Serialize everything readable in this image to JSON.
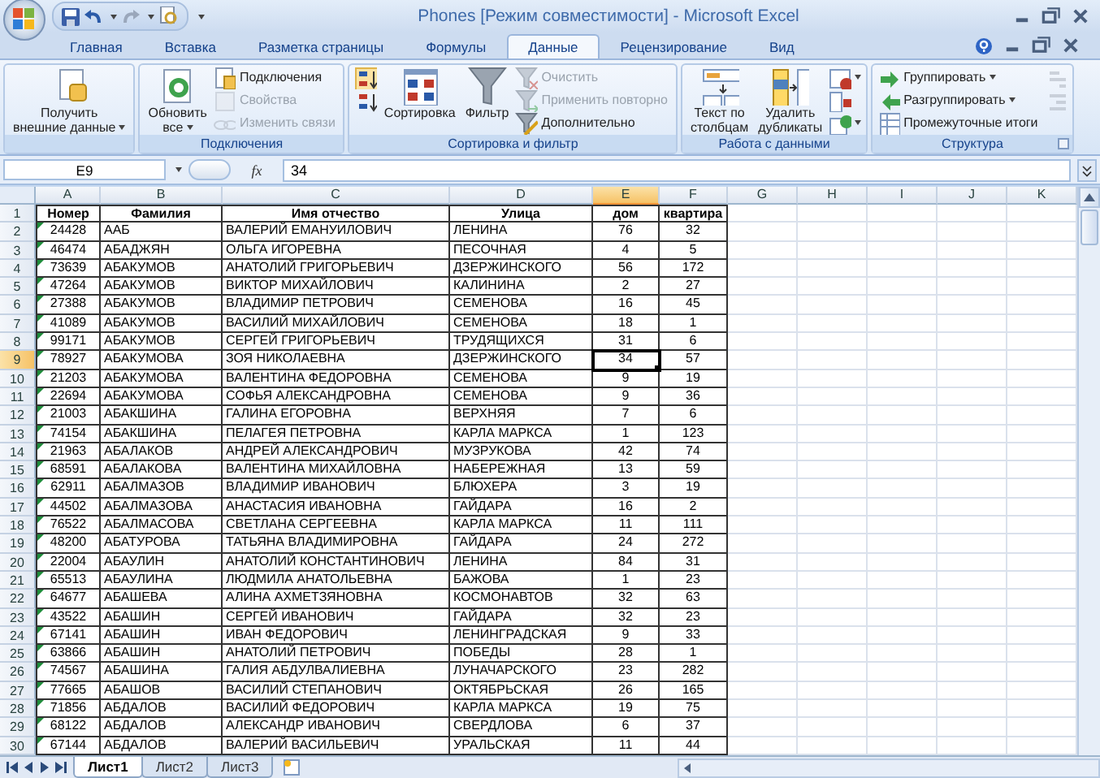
{
  "title_bar": {
    "title": "Phones  [Режим совместимости] - Microsoft Excel"
  },
  "ribbon_tabs": [
    {
      "label": "Главная",
      "selected": false
    },
    {
      "label": "Вставка",
      "selected": false
    },
    {
      "label": "Разметка страницы",
      "selected": false
    },
    {
      "label": "Формулы",
      "selected": false
    },
    {
      "label": "Данные",
      "selected": true
    },
    {
      "label": "Рецензирование",
      "selected": false
    },
    {
      "label": "Вид",
      "selected": false
    }
  ],
  "ribbon_groups": [
    {
      "items": [
        {
          "kind": "large",
          "label": "Получить\nвнешние данные",
          "dropdown": true,
          "disabled": false
        }
      ]
    },
    {
      "label": "Подключения",
      "items": [
        {
          "kind": "large",
          "label": "Обновить\nвсе",
          "dropdown": true,
          "disabled": false
        },
        {
          "kind": "small",
          "label": "Подключения",
          "dropdown": false,
          "disabled": false
        },
        {
          "kind": "small",
          "label": "Свойства",
          "dropdown": false,
          "disabled": true
        },
        {
          "kind": "small",
          "label": "Изменить связи",
          "dropdown": false,
          "disabled": true
        }
      ]
    },
    {
      "label": "Сортировка и фильтр",
      "items": [
        {
          "kind": "icon",
          "dropdown": false,
          "disabled": false
        },
        {
          "kind": "icon",
          "dropdown": false,
          "disabled": false
        },
        {
          "kind": "large",
          "label": "Сортировка",
          "dropdown": false,
          "disabled": false
        },
        {
          "kind": "large",
          "label": "Фильтр",
          "dropdown": false,
          "disabled": false
        },
        {
          "kind": "small",
          "label": "Очистить",
          "dropdown": false,
          "disabled": true
        },
        {
          "kind": "small",
          "label": "Применить повторно",
          "dropdown": false,
          "disabled": true
        },
        {
          "kind": "small",
          "label": "Дополнительно",
          "dropdown": false,
          "disabled": false
        }
      ]
    },
    {
      "label": "Работа с данными",
      "items": [
        {
          "kind": "large",
          "label": "Текст по\nстолбцам",
          "dropdown": false,
          "disabled": false
        },
        {
          "kind": "large",
          "label": "Удалить\nдубликаты",
          "dropdown": false,
          "disabled": false
        },
        {
          "kind": "icon",
          "dropdown": true,
          "disabled": false
        },
        {
          "kind": "icon",
          "dropdown": false,
          "disabled": false
        },
        {
          "kind": "icon",
          "dropdown": true,
          "disabled": false
        }
      ]
    },
    {
      "label": "Структура",
      "launcher": true,
      "items": [
        {
          "kind": "small",
          "label": "Группировать",
          "dropdown": true,
          "disabled": false
        },
        {
          "kind": "small",
          "label": "Разгруппировать",
          "dropdown": true,
          "disabled": false
        },
        {
          "kind": "small",
          "label": "Промежуточные итоги",
          "dropdown": false,
          "disabled": false
        },
        {
          "kind": "icon",
          "dropdown": false,
          "disabled": true
        },
        {
          "kind": "icon",
          "dropdown": false,
          "disabled": true
        }
      ]
    }
  ],
  "formula_bar": {
    "name_box": "E9",
    "function_label": "fx",
    "value": "34"
  },
  "columns": [
    {
      "label": "A",
      "selected": false
    },
    {
      "label": "B",
      "selected": false
    },
    {
      "label": "C",
      "selected": false
    },
    {
      "label": "D",
      "selected": false
    },
    {
      "label": "E",
      "selected": true
    },
    {
      "label": "F",
      "selected": false
    },
    {
      "label": "G",
      "selected": false
    },
    {
      "label": "H",
      "selected": false
    },
    {
      "label": "I",
      "selected": false
    },
    {
      "label": "J",
      "selected": false
    },
    {
      "label": "K",
      "selected": false
    }
  ],
  "rows": [
    {
      "number": "1",
      "kind": "header",
      "selected": false,
      "error_marker": false,
      "cells": [
        "Номер",
        "Фамилия",
        "Имя отчество",
        "Улица",
        "дом",
        "квартира"
      ]
    },
    {
      "number": "2",
      "kind": "data",
      "selected": false,
      "error_marker": true,
      "cells": [
        "24428",
        "ААБ",
        "ВАЛЕРИЙ ЕМАНУИЛОВИЧ",
        "ЛЕНИНА",
        "76",
        "32"
      ]
    },
    {
      "number": "3",
      "kind": "data",
      "selected": false,
      "error_marker": true,
      "cells": [
        "46474",
        "АБАДЖЯН",
        "ОЛЬГА ИГОРЕВНА",
        "ПЕСОЧНАЯ",
        "4",
        "5"
      ]
    },
    {
      "number": "4",
      "kind": "data",
      "selected": false,
      "error_marker": true,
      "cells": [
        "73639",
        "АБАКУМОВ",
        "АНАТОЛИЙ ГРИГОРЬЕВИЧ",
        "ДЗЕРЖИНСКОГО",
        "56",
        "172"
      ]
    },
    {
      "number": "5",
      "kind": "data",
      "selected": false,
      "error_marker": true,
      "cells": [
        "47264",
        "АБАКУМОВ",
        "ВИКТОР МИХАЙЛОВИЧ",
        "КАЛИНИНА",
        "2",
        "27"
      ]
    },
    {
      "number": "6",
      "kind": "data",
      "selected": false,
      "error_marker": true,
      "cells": [
        "27388",
        "АБАКУМОВ",
        "ВЛАДИМИР ПЕТРОВИЧ",
        "СЕМЕНОВА",
        "16",
        "45"
      ]
    },
    {
      "number": "7",
      "kind": "data",
      "selected": false,
      "error_marker": true,
      "cells": [
        "41089",
        "АБАКУМОВ",
        "ВАСИЛИЙ МИХАЙЛОВИЧ",
        "СЕМЕНОВА",
        "18",
        "1"
      ]
    },
    {
      "number": "8",
      "kind": "data",
      "selected": false,
      "error_marker": true,
      "cells": [
        "99171",
        "АБАКУМОВ",
        "СЕРГЕЙ ГРИГОРЬЕВИЧ",
        "ТРУДЯЩИХСЯ",
        "31",
        "6"
      ]
    },
    {
      "number": "9",
      "kind": "data",
      "selected": true,
      "error_marker": true,
      "cells": [
        "78927",
        "АБАКУМОВА",
        "ЗОЯ НИКОЛАЕВНА",
        "ДЗЕРЖИНСКОГО",
        "34",
        "57"
      ]
    },
    {
      "number": "10",
      "kind": "data",
      "selected": false,
      "error_marker": true,
      "cells": [
        "21203",
        "АБАКУМОВА",
        "ВАЛЕНТИНА ФЕДОРОВНА",
        "СЕМЕНОВА",
        "9",
        "19"
      ]
    },
    {
      "number": "11",
      "kind": "data",
      "selected": false,
      "error_marker": true,
      "cells": [
        "22694",
        "АБАКУМОВА",
        "СОФЬЯ АЛЕКСАНДРОВНА",
        "СЕМЕНОВА",
        "9",
        "36"
      ]
    },
    {
      "number": "12",
      "kind": "data",
      "selected": false,
      "error_marker": true,
      "cells": [
        "21003",
        "АБАКШИНА",
        "ГАЛИНА ЕГОРОВНА",
        "ВЕРХНЯЯ",
        "7",
        "6"
      ]
    },
    {
      "number": "13",
      "kind": "data",
      "selected": false,
      "error_marker": true,
      "cells": [
        "74154",
        "АБАКШИНА",
        "ПЕЛАГЕЯ ПЕТРОВНА",
        "КАРЛА МАРКСА",
        "1",
        "123"
      ]
    },
    {
      "number": "14",
      "kind": "data",
      "selected": false,
      "error_marker": true,
      "cells": [
        "21963",
        "АБАЛАКОВ",
        "АНДРЕЙ АЛЕКСАНДРОВИЧ",
        "МУЗРУКОВА",
        "42",
        "74"
      ]
    },
    {
      "number": "15",
      "kind": "data",
      "selected": false,
      "error_marker": true,
      "cells": [
        "68591",
        "АБАЛАКОВА",
        "ВАЛЕНТИНА МИХАЙЛОВНА",
        "НАБЕРЕЖНАЯ",
        "13",
        "59"
      ]
    },
    {
      "number": "16",
      "kind": "data",
      "selected": false,
      "error_marker": true,
      "cells": [
        "62911",
        "АБАЛМАЗОВ",
        "ВЛАДИМИР ИВАНОВИЧ",
        "БЛЮХЕРА",
        "3",
        "19"
      ]
    },
    {
      "number": "17",
      "kind": "data",
      "selected": false,
      "error_marker": true,
      "cells": [
        "44502",
        "АБАЛМАЗОВА",
        "АНАСТАСИЯ ИВАНОВНА",
        "ГАЙДАРА",
        "16",
        "2"
      ]
    },
    {
      "number": "18",
      "kind": "data",
      "selected": false,
      "error_marker": true,
      "cells": [
        "76522",
        "АБАЛМАСОВА",
        "СВЕТЛАНА СЕРГЕЕВНА",
        "КАРЛА МАРКСА",
        "11",
        "111"
      ]
    },
    {
      "number": "19",
      "kind": "data",
      "selected": false,
      "error_marker": true,
      "cells": [
        "48200",
        "АБАТУРОВА",
        "ТАТЬЯНА ВЛАДИМИРОВНА",
        "ГАЙДАРА",
        "24",
        "272"
      ]
    },
    {
      "number": "20",
      "kind": "data",
      "selected": false,
      "error_marker": true,
      "cells": [
        "22004",
        "АБАУЛИН",
        "АНАТОЛИЙ КОНСТАНТИНОВИЧ",
        "ЛЕНИНА",
        "84",
        "31"
      ]
    },
    {
      "number": "21",
      "kind": "data",
      "selected": false,
      "error_marker": true,
      "cells": [
        "65513",
        "АБАУЛИНА",
        "ЛЮДМИЛА АНАТОЛЬЕВНА",
        "БАЖОВА",
        "1",
        "23"
      ]
    },
    {
      "number": "22",
      "kind": "data",
      "selected": false,
      "error_marker": true,
      "cells": [
        "64677",
        "АБАШЕВА",
        "АЛИНА АХМЕТЗЯНОВНА",
        "КОСМОНАВТОВ",
        "32",
        "63"
      ]
    },
    {
      "number": "23",
      "kind": "data",
      "selected": false,
      "error_marker": true,
      "cells": [
        "43522",
        "АБАШИН",
        "СЕРГЕЙ ИВАНОВИЧ",
        "ГАЙДАРА",
        "32",
        "23"
      ]
    },
    {
      "number": "24",
      "kind": "data",
      "selected": false,
      "error_marker": true,
      "cells": [
        "67141",
        "АБАШИН",
        "ИВАН ФЕДОРОВИЧ",
        "ЛЕНИНГРАДСКАЯ",
        "9",
        "33"
      ]
    },
    {
      "number": "25",
      "kind": "data",
      "selected": false,
      "error_marker": true,
      "cells": [
        "63866",
        "АБАШИН",
        "АНАТОЛИЙ ПЕТРОВИЧ",
        "ПОБЕДЫ",
        "28",
        "1"
      ]
    },
    {
      "number": "26",
      "kind": "data",
      "selected": false,
      "error_marker": true,
      "cells": [
        "74567",
        "АБАШИНА",
        "ГАЛИЯ АБДУЛВАЛИЕВНА",
        "ЛУНАЧАРСКОГО",
        "23",
        "282"
      ]
    },
    {
      "number": "27",
      "kind": "data",
      "selected": false,
      "error_marker": true,
      "cells": [
        "77665",
        "АБАШОВ",
        "ВАСИЛИЙ СТЕПАНОВИЧ",
        "ОКТЯБРЬСКАЯ",
        "26",
        "165"
      ]
    },
    {
      "number": "28",
      "kind": "data",
      "selected": false,
      "error_marker": true,
      "cells": [
        "71856",
        "АБДАЛОВ",
        "ВАСИЛИЙ ФЕДОРОВИЧ",
        "КАРЛА МАРКСА",
        "19",
        "75"
      ]
    },
    {
      "number": "29",
      "kind": "data",
      "selected": false,
      "error_marker": true,
      "cells": [
        "68122",
        "АБДАЛОВ",
        "АЛЕКСАНДР ИВАНОВИЧ",
        "СВЕРДЛОВА",
        "6",
        "37"
      ]
    },
    {
      "number": "30",
      "kind": "data",
      "selected": false,
      "error_marker": true,
      "cells": [
        "67144",
        "АБДАЛОВ",
        "ВАЛЕРИЙ ВАСИЛЬЕВИЧ",
        "УРАЛЬСКАЯ",
        "11",
        "44"
      ]
    }
  ],
  "sheet_tabs": [
    {
      "label": "Лист1",
      "selected": true
    },
    {
      "label": "Лист2",
      "selected": false
    },
    {
      "label": "Лист3",
      "selected": false
    }
  ]
}
